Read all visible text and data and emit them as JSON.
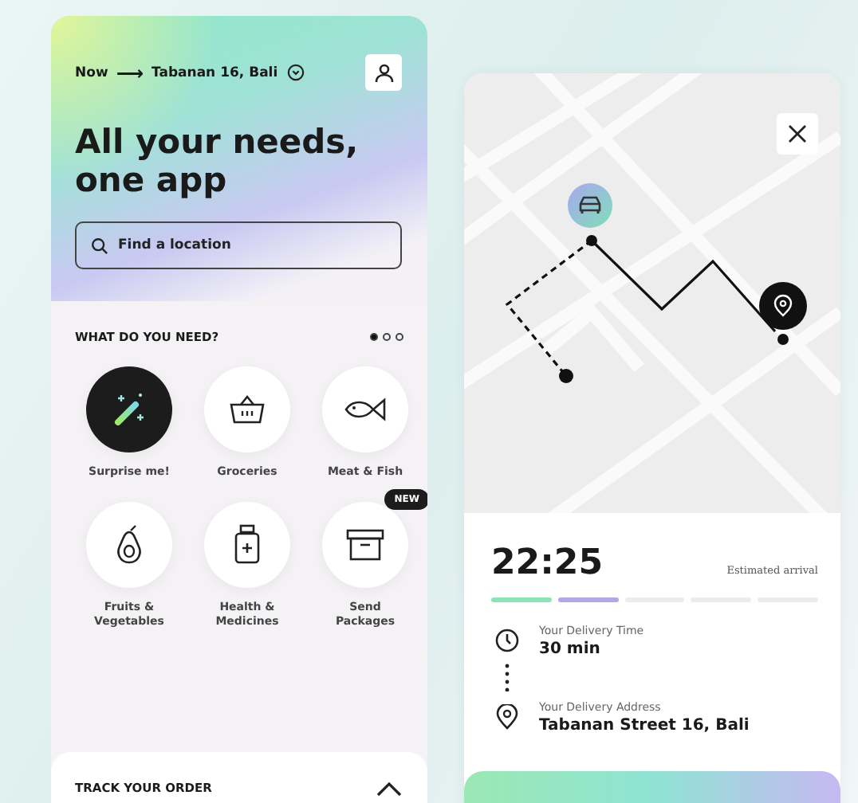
{
  "header": {
    "when": "Now",
    "arrow": "⟶",
    "location": "Tabanan 16, Bali"
  },
  "title": "All your needs, one app",
  "search": {
    "placeholder": "Find a location"
  },
  "section": {
    "title": "WHAT DO YOU NEED?",
    "pages": [
      {
        "selected": true
      },
      {
        "selected": false
      },
      {
        "selected": false
      }
    ]
  },
  "categories": [
    {
      "label": "Surprise me!",
      "kind": "wand",
      "selected": true
    },
    {
      "label": "Groceries",
      "kind": "basket",
      "selected": false
    },
    {
      "label": "Meat & Fish",
      "kind": "fish",
      "selected": false
    },
    {
      "label": "Fruits & Vegetables",
      "kind": "avocado",
      "selected": false
    },
    {
      "label": "Health & Medicines",
      "kind": "medicine",
      "selected": false
    },
    {
      "label": "Send Packages",
      "kind": "box",
      "selected": false,
      "badge": "NEW"
    }
  ],
  "track": {
    "title": "TRACK YOUR ORDER",
    "expanded": false
  },
  "delivery": {
    "time": "22:25",
    "time_caption": "Estimated arrival",
    "progress": [
      {
        "color": "#8fe3b8"
      },
      {
        "color": "#b3a6ea"
      },
      {
        "color": "#ececec"
      },
      {
        "color": "#ececec"
      },
      {
        "color": "#ececec"
      }
    ],
    "details": [
      {
        "kind": "clock",
        "label": "Your Delivery Time",
        "value": "30 min"
      },
      {
        "kind": "pin",
        "label": "Your Delivery Address",
        "value": "Tabanan Street 16, Bali"
      }
    ]
  }
}
